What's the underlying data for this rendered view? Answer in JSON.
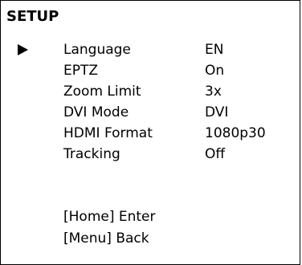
{
  "menu": {
    "title": "SETUP",
    "items": [
      {
        "label": "Language",
        "value": "EN"
      },
      {
        "label": "EPTZ",
        "value": "On"
      },
      {
        "label": "Zoom Limit",
        "value": "3x"
      },
      {
        "label": "DVI Mode",
        "value": "DVI"
      },
      {
        "label": "HDMI Format",
        "value": "1080p30"
      },
      {
        "label": "Tracking",
        "value": "Off"
      }
    ],
    "selected_index": 0,
    "hints": {
      "enter": "[Home] Enter",
      "back": "[Menu] Back"
    }
  }
}
